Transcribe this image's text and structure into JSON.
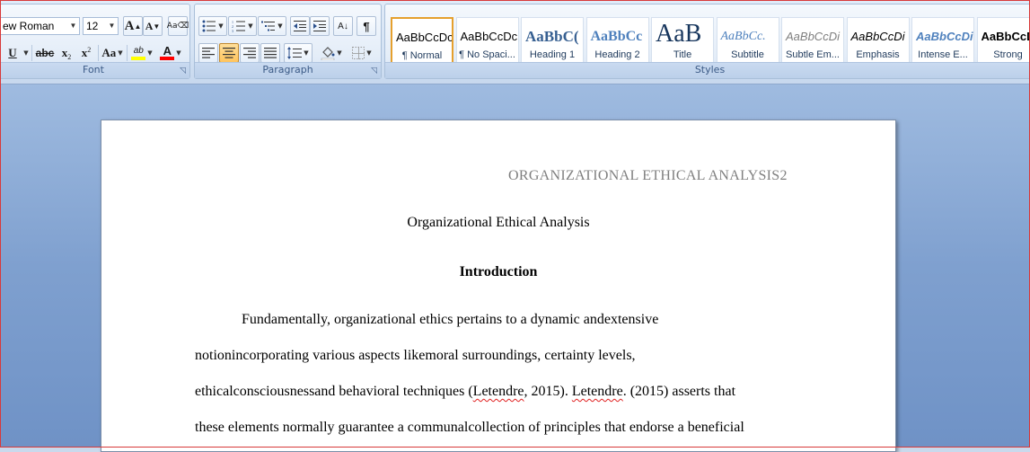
{
  "ribbon": {
    "font": {
      "label": "Font",
      "font_name": "ew Roman",
      "font_size": "12",
      "grow_font": "A",
      "shrink_font": "A",
      "underline": "U",
      "strikethrough": "abc",
      "subscript": "x",
      "superscript": "x",
      "change_case": "Aa",
      "highlight": "ab",
      "font_color_glyph": "A",
      "highlight_color": "#ffff00",
      "font_color": "#ff0000"
    },
    "paragraph": {
      "label": "Paragraph",
      "sort_glyph": "A↓",
      "pilcrow": "¶"
    },
    "styles": {
      "label": "Styles",
      "items": [
        {
          "sample": "AaBbCcDc",
          "name": "¶ Normal"
        },
        {
          "sample": "AaBbCcDc",
          "name": "¶ No Spaci..."
        },
        {
          "sample": "AaBbC(",
          "name": "Heading 1"
        },
        {
          "sample": "AaBbCc",
          "name": "Heading 2"
        },
        {
          "sample": "AaB",
          "name": "Title"
        },
        {
          "sample": "AaBbCc.",
          "name": "Subtitle"
        },
        {
          "sample": "AaBbCcDi",
          "name": "Subtle Em..."
        },
        {
          "sample": "AaBbCcDi",
          "name": "Emphasis"
        },
        {
          "sample": "AaBbCcDi",
          "name": "Intense E..."
        },
        {
          "sample": "AaBbCcDc",
          "name": "Strong"
        }
      ]
    }
  },
  "document": {
    "header": "ORGANIZATIONAL  ETHICAL  ANALYSIS2",
    "title": "Organizational Ethical Analysis",
    "heading": "Introduction",
    "lines": {
      "l1": "Fundamentally, organizational ethics pertains to a dynamic andextensive",
      "l2": "notionincorporating various aspects likemoral surroundings, certainty levels,",
      "l3_a": "ethicalconsciousnessand behavioral techniques (",
      "l3_b": "Letendre",
      "l3_c": ", 2015). ",
      "l3_d": "Letendre",
      "l3_e": ". (2015) asserts that",
      "l4": "these elements normally guarantee a communalcollection of principles that endorse a beneficial"
    }
  }
}
